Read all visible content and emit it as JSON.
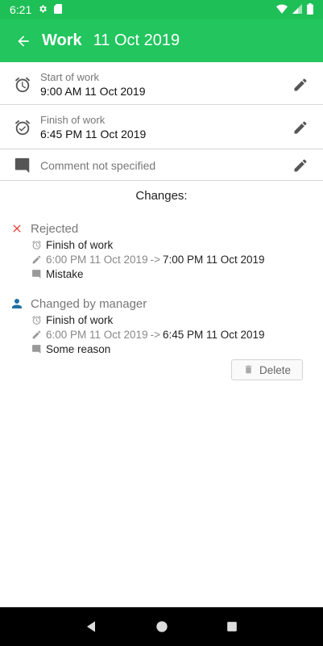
{
  "status_bar": {
    "time": "6:21"
  },
  "app_bar": {
    "title": "Work",
    "date": "11 Oct 2019"
  },
  "start": {
    "label": "Start of work",
    "value": "9:00 AM 11 Oct 2019"
  },
  "finish": {
    "label": "Finish of work",
    "value": "6:45 PM 11 Oct 2019"
  },
  "comment": {
    "text": "Comment not specified"
  },
  "changes": {
    "heading": "Changes:",
    "items": [
      {
        "title": "Rejected",
        "field": "Finish of work",
        "old": "6:00 PM 11 Oct 2019",
        "arrow": "->",
        "new": "7:00 PM 11 Oct 2019",
        "note": "Mistake"
      },
      {
        "title": "Changed by manager",
        "field": "Finish of work",
        "old": "6:00 PM 11 Oct 2019",
        "arrow": "->",
        "new": "6:45 PM 11 Oct 2019",
        "note": "Some reason"
      }
    ]
  },
  "delete_button": {
    "label": "Delete"
  },
  "colors": {
    "accent": "#22c55e",
    "rejected": "#e53935",
    "manager": "#1e6fa8"
  }
}
